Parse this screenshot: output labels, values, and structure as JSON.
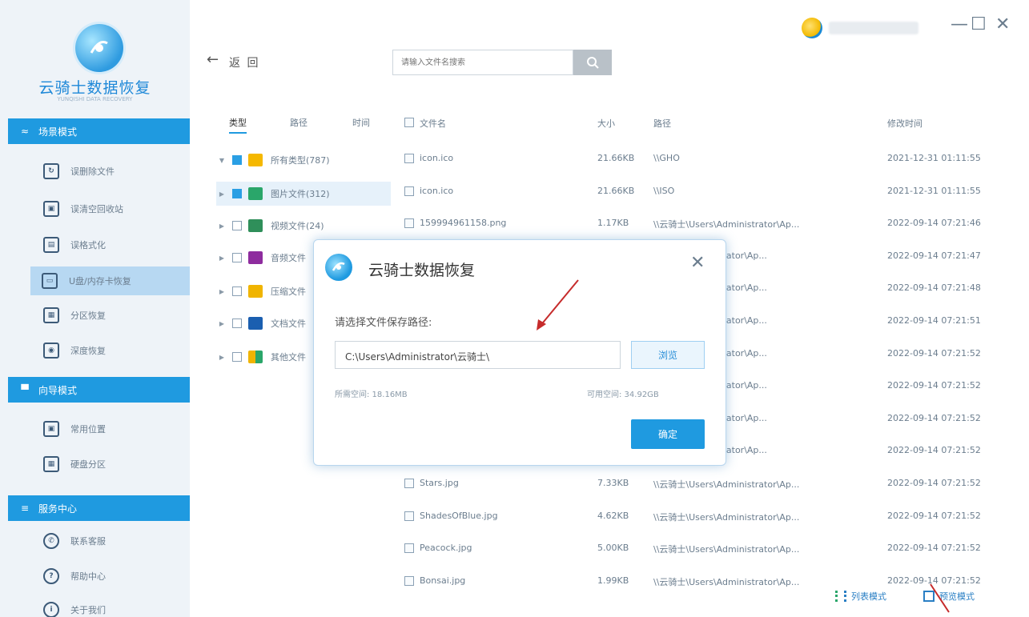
{
  "app": {
    "name": "云骑士数据恢复",
    "subtitle": "YUNQISHI DATA RECOVERY",
    "colors": {
      "accent": "#1f9ae0",
      "sidebar": "#eef3f8",
      "active_item": "#b7d8f2"
    }
  },
  "sidebar": {
    "groups": [
      {
        "label": "场景模式",
        "icon": "waves-icon"
      },
      {
        "label": "向导模式",
        "icon": "monitor-icon"
      },
      {
        "label": "服务中心",
        "icon": "list-icon"
      }
    ],
    "scene_items": [
      {
        "label": "误删除文件",
        "icon": "recycle-icon"
      },
      {
        "label": "误清空回收站",
        "icon": "trash-icon"
      },
      {
        "label": "误格式化",
        "icon": "disk-icon"
      },
      {
        "label": "U盘/内存卡恢复",
        "icon": "usb-icon",
        "active": true
      },
      {
        "label": "分区恢复",
        "icon": "partition-icon"
      },
      {
        "label": "深度恢复",
        "icon": "deep-scan-icon"
      }
    ],
    "guide_items": [
      {
        "label": "常用位置",
        "icon": "location-icon"
      },
      {
        "label": "硬盘分区",
        "icon": "drive-icon"
      }
    ],
    "service_items": [
      {
        "label": "联系客服",
        "icon": "phone-icon"
      },
      {
        "label": "帮助中心",
        "icon": "help-icon"
      },
      {
        "label": "关于我们",
        "icon": "info-icon"
      }
    ]
  },
  "toolbar": {
    "back_arrow": "←",
    "breadcrumb": "返 回",
    "search_placeholder": "请输入文件名搜索"
  },
  "window": {
    "minimize": "—",
    "maximize": "☐",
    "close": "✕"
  },
  "tree": {
    "tabs": [
      "类型",
      "路径",
      "时间"
    ],
    "items": [
      {
        "label": "所有类型(787)",
        "checked": true
      },
      {
        "label": "图片文件(312)",
        "checked": true,
        "selected": true
      },
      {
        "label": "视频文件(24)",
        "checked": false
      },
      {
        "label": "音频文件",
        "checked": false
      },
      {
        "label": "压缩文件",
        "checked": false
      },
      {
        "label": "文档文件",
        "checked": false
      },
      {
        "label": "其他文件",
        "checked": false
      }
    ]
  },
  "files": {
    "headers": {
      "name": "文件名",
      "size": "大小",
      "path": "路径",
      "time": "修改时间"
    },
    "rows": [
      {
        "name": "icon.ico",
        "size": "21.66KB",
        "path": "\\\\GHO",
        "time": "2021-12-31 01:11:55"
      },
      {
        "name": "icon.ico",
        "size": "21.66KB",
        "path": "\\\\ISO",
        "time": "2021-12-31 01:11:55"
      },
      {
        "name": "159994961158.png",
        "size": "1.17KB",
        "path": "\\\\云骑士\\Users\\Administrator\\Ap...",
        "time": "2022-09-14 07:21:46"
      },
      {
        "name": "",
        "size": "",
        "path": "\\Users\\Administrator\\Ap...",
        "time": "2022-09-14 07:21:47"
      },
      {
        "name": "",
        "size": "",
        "path": "\\Users\\Administrator\\Ap...",
        "time": "2022-09-14 07:21:48"
      },
      {
        "name": "",
        "size": "",
        "path": "\\Users\\Administrator\\Ap...",
        "time": "2022-09-14 07:21:51"
      },
      {
        "name": "",
        "size": "",
        "path": "\\Users\\Administrator\\Ap...",
        "time": "2022-09-14 07:21:52"
      },
      {
        "name": "",
        "size": "",
        "path": "\\Users\\Administrator\\Ap...",
        "time": "2022-09-14 07:21:52"
      },
      {
        "name": "",
        "size": "",
        "path": "\\Users\\Administrator\\Ap...",
        "time": "2022-09-14 07:21:52"
      },
      {
        "name": "",
        "size": "",
        "path": "\\Users\\Administrator\\Ap...",
        "time": "2022-09-14 07:21:52"
      },
      {
        "name": "Stars.jpg",
        "size": "7.33KB",
        "path": "\\\\云骑士\\Users\\Administrator\\Ap...",
        "time": "2022-09-14 07:21:52"
      },
      {
        "name": "ShadesOfBlue.jpg",
        "size": "4.62KB",
        "path": "\\\\云骑士\\Users\\Administrator\\Ap...",
        "time": "2022-09-14 07:21:52"
      },
      {
        "name": "Peacock.jpg",
        "size": "5.00KB",
        "path": "\\\\云骑士\\Users\\Administrator\\Ap...",
        "time": "2022-09-14 07:21:52"
      },
      {
        "name": "Bonsai.jpg",
        "size": "1.99KB",
        "path": "\\\\云骑士\\Users\\Administrator\\Ap...",
        "time": "2022-09-14 07:21:52"
      }
    ]
  },
  "view_modes": {
    "list": "列表模式",
    "thumb": "预览模式"
  },
  "dialog": {
    "title": "云骑士数据恢复",
    "close": "✕",
    "label": "请选择文件保存路径:",
    "path_value": "C:\\Users\\Administrator\\云骑士\\",
    "browse": "浏览",
    "required_space": "所需空间: 18.16MB",
    "available_space": "可用空间: 34.92GB",
    "confirm": "确定"
  }
}
